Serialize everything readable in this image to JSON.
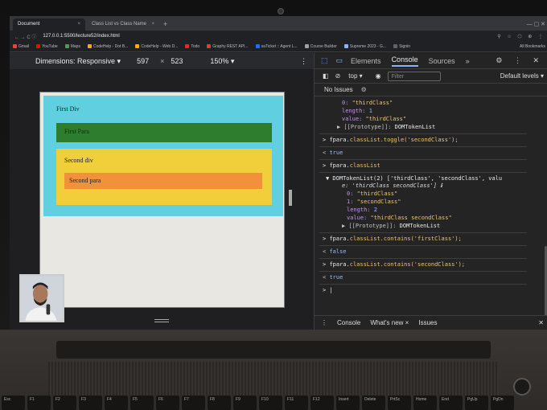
{
  "browser": {
    "tabs": [
      {
        "title": "Document",
        "close": "×"
      },
      {
        "title": "Class List vs Class Name",
        "close": "×"
      }
    ],
    "new_tab": "+",
    "window_controls": "—  ▢  ✕",
    "url": "127.0.0.1:5500/lecture52/index.html",
    "nav": "←  →  C  ⓘ",
    "extensions": "⚲ ☆ ⬡ ⊕ ⋮",
    "bookmarks": [
      {
        "label": "Gmail",
        "color": "#ea4335"
      },
      {
        "label": "YouTube",
        "color": "#ff0000"
      },
      {
        "label": "Maps",
        "color": "#34a853"
      },
      {
        "label": "CodeHelp - Dot B...",
        "color": "#f9ab00"
      },
      {
        "label": "CodeHelp - Web D...",
        "color": "#f9ab00"
      },
      {
        "label": "Todo",
        "color": "#d93025"
      },
      {
        "label": "Graphy REST API...",
        "color": "#e53935"
      },
      {
        "label": "saTicket :: Agent L...",
        "color": "#1a73e8"
      },
      {
        "label": "Course Builder",
        "color": "#9aa0a6"
      },
      {
        "label": "Supreme 2023 - G...",
        "color": "#8ab4f8"
      },
      {
        "label": "Signin",
        "color": "#5f6368"
      }
    ],
    "bookmarks_right": "All Bookmarks"
  },
  "device_toolbar": {
    "dimensions_label": "Dimensions: Responsive ▾",
    "width": "597",
    "times": "×",
    "height": "523",
    "zoom": "150% ▾",
    "kebab": "⋮"
  },
  "page": {
    "first_div": "First Div",
    "first_para": "First Para",
    "second_div": "Second div",
    "second_para": "Second para"
  },
  "devtools": {
    "tabs": [
      "Elements",
      "Console",
      "Sources"
    ],
    "active_tab": "Console",
    "more_tabs": "»",
    "top_right_icons": "⚙ ⋮ ✕",
    "context": "top ▾",
    "filter_placeholder": "Filter",
    "default_levels": "Default levels ▾",
    "issues": "No Issues",
    "drawer_tabs": [
      "Console",
      "What's new ×",
      "Issues"
    ],
    "drawer_close": "✕",
    "console": {
      "l1_key": "0:",
      "l1_val": "\"thirdClass\"",
      "l2_key": "length:",
      "l2_val": "1",
      "l3_key": "value:",
      "l3_val": "\"thirdClass\"",
      "l4_key": "▶ [[Prototype]]:",
      "l4_val": "DOMTokenList",
      "c1_a": "fpara.",
      "c1_m": "classList.toggle",
      "c1_b": "('secondClass');",
      "r1": "true",
      "c2_a": "fpara.",
      "c2_m": "classList",
      "r2_head": "▼ DOMTokenList(2) ['thirdClass', 'secondClass', valu",
      "r2_head2": "e: 'thirdClass secondClass'] ℹ",
      "r2_l1_key": "0:",
      "r2_l1_val": "\"thirdClass\"",
      "r2_l2_key": "1:",
      "r2_l2_val": "\"secondClass\"",
      "r2_l3_key": "length:",
      "r2_l3_val": "2",
      "r2_l4_key": "value:",
      "r2_l4_val": "\"thirdClass secondClass\"",
      "r2_l5_key": "▶ [[Prototype]]:",
      "r2_l5_val": "DOMTokenList",
      "c3_a": "fpara.",
      "c3_m": "classList.contains",
      "c3_b": "('firstClass');",
      "r3": "false",
      "c4_a": "fpara.",
      "c4_m": "classList.contains",
      "c4_b": "('secondClass');",
      "r4": "true",
      "prompt": "> |"
    }
  },
  "keyboard": [
    "Esc",
    "F1",
    "F2",
    "F3",
    "F4",
    "F5",
    "F6",
    "F7",
    "F8",
    "F9",
    "F10",
    "F11",
    "F12",
    "Insert",
    "Delete",
    "PrtSc",
    "Home",
    "End",
    "PgUp",
    "PgDn"
  ]
}
